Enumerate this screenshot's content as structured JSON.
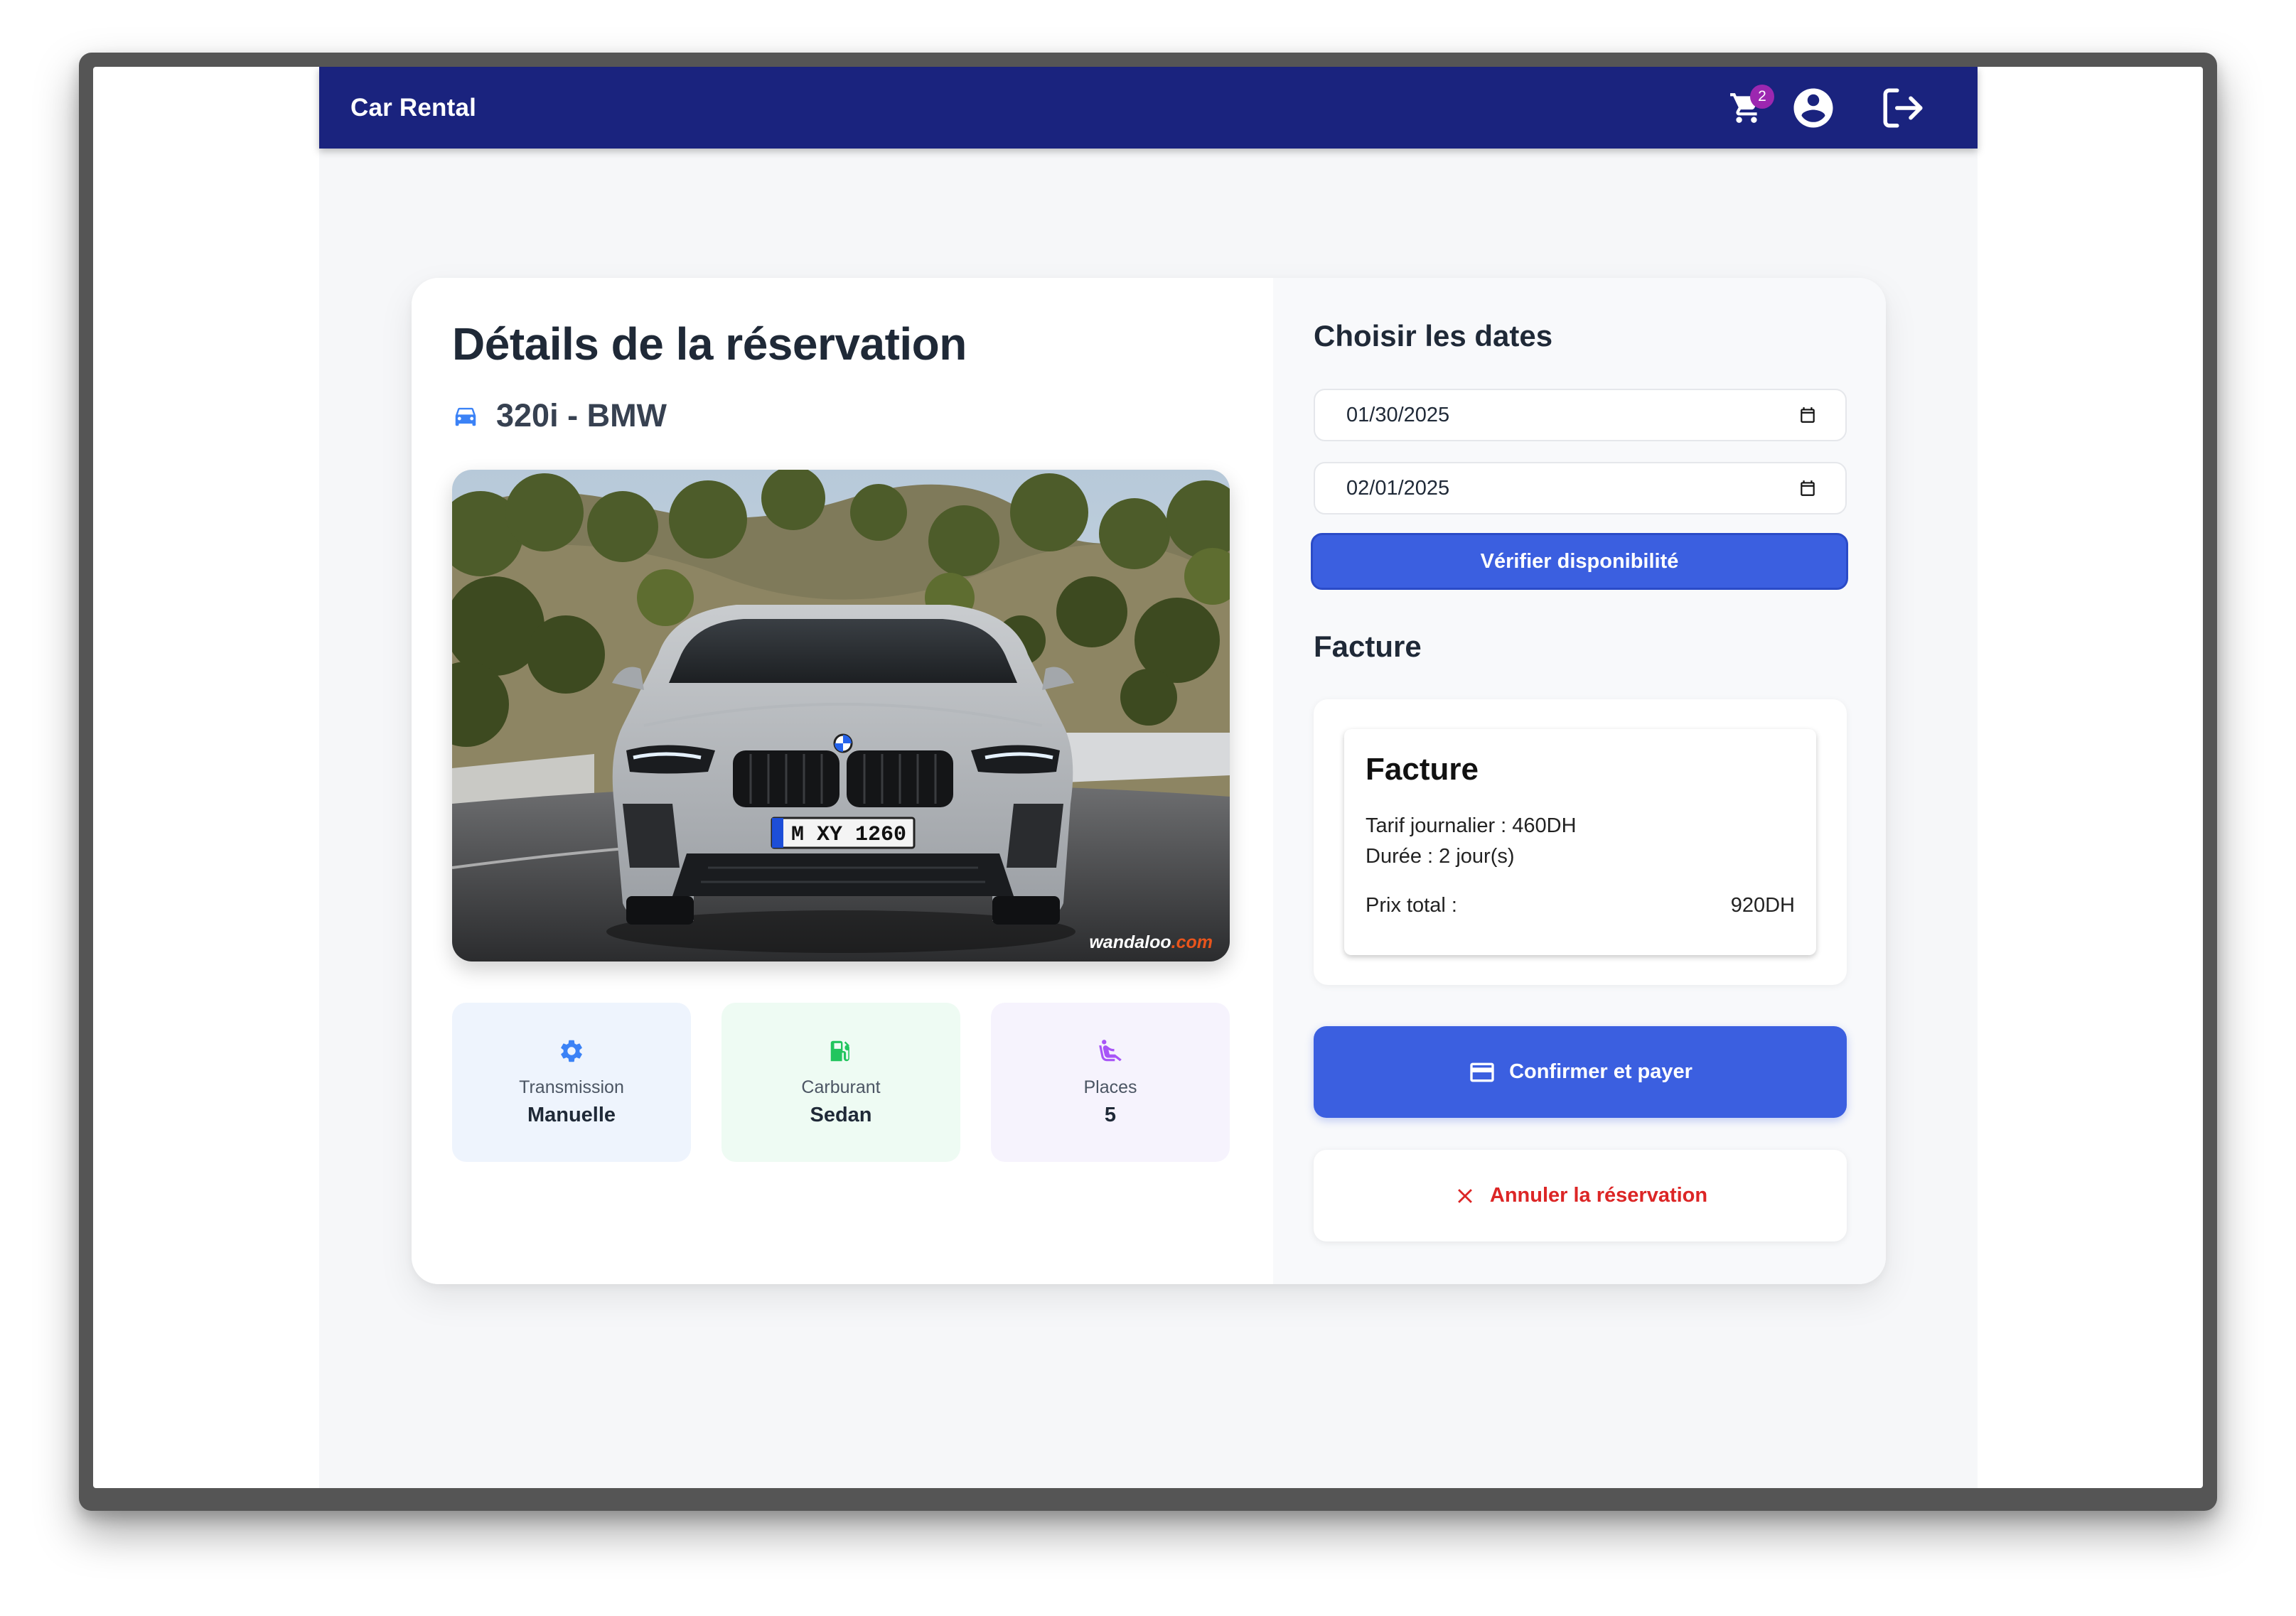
{
  "app": {
    "brand": "Car Rental",
    "cart_count": "2"
  },
  "reservation": {
    "title": "Détails de la réservation",
    "car_name": "320i - BMW",
    "photo": {
      "plate": "M XY 1260",
      "watermark_main": "wandaloo",
      "watermark_suffix": ".com"
    },
    "specs": [
      {
        "label": "Transmission",
        "value": "Manuelle",
        "icon": "gear-icon",
        "color": "#3b82f6"
      },
      {
        "label": "Carburant",
        "value": "Sedan",
        "icon": "fuel-pump-icon",
        "color": "#22c55e"
      },
      {
        "label": "Places",
        "value": "5",
        "icon": "seat-icon",
        "color": "#a855f7"
      }
    ]
  },
  "dates": {
    "heading": "Choisir les dates",
    "start": "01/30/2025",
    "end": "02/01/2025",
    "verify_label": "Vérifier disponibilité"
  },
  "invoice": {
    "heading": "Facture",
    "card_title": "Facture",
    "daily_rate": "Tarif journalier : 460DH",
    "duration": "Durée : 2 jour(s)",
    "total_label": "Prix total :",
    "total_value": "920DH"
  },
  "actions": {
    "pay_label": "Confirmer et payer",
    "cancel_label": "Annuler la réservation"
  },
  "colors": {
    "navbar": "#1a237e",
    "primary": "#3b5fe0",
    "danger": "#dc2626",
    "badge": "#9c27b0"
  }
}
